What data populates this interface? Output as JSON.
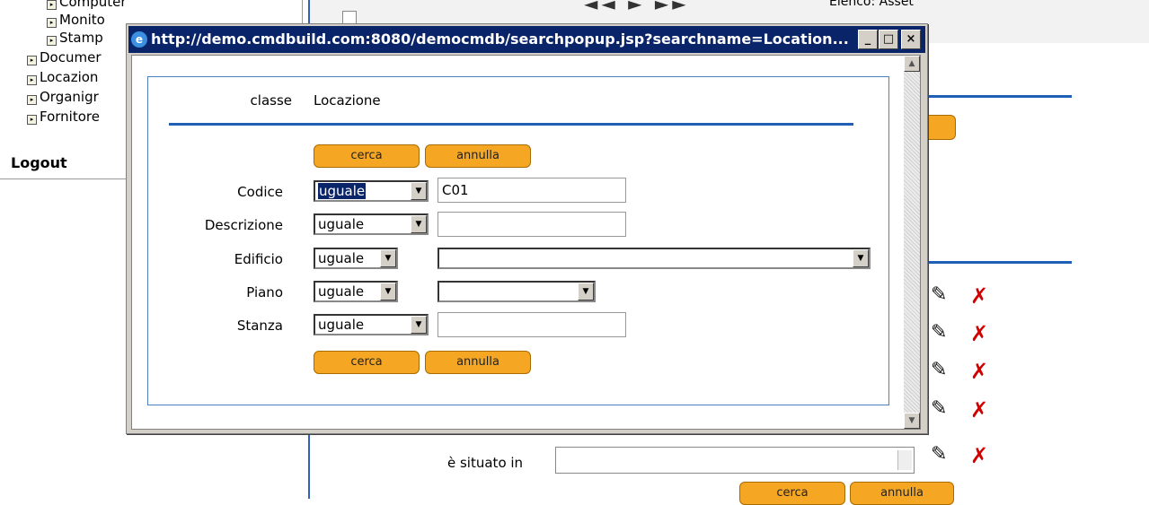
{
  "sidebar": {
    "items": [
      {
        "label": "Computer",
        "indent": 2
      },
      {
        "label": "Monito",
        "indent": 2
      },
      {
        "label": "Stamp",
        "indent": 2
      },
      {
        "label": "Documer",
        "indent": 1
      },
      {
        "label": "Locazion",
        "indent": 1
      },
      {
        "label": "Organigr",
        "indent": 1
      },
      {
        "label": "Fornitore",
        "indent": 1
      }
    ],
    "logout": "Logout"
  },
  "background": {
    "list_title": "Elenco: Asset",
    "situato_label": "è situato in",
    "search_label": "cerca",
    "cancel_label": "annulla"
  },
  "popup": {
    "title": "http://demo.cmdbuild.com:8080/democmdb/searchpopup.jsp?searchname=Location...",
    "window_buttons": {
      "minimize": "_",
      "maximize": "□",
      "close": "×"
    },
    "class_label": "classe",
    "class_value": "Locazione",
    "search_label": "cerca",
    "cancel_label": "annulla",
    "fields": [
      {
        "label": "Codice",
        "operator": "uguale",
        "value": "C01"
      },
      {
        "label": "Descrizione",
        "operator": "uguale",
        "value": ""
      },
      {
        "label": "Edificio",
        "operator": "uguale",
        "value": ""
      },
      {
        "label": "Piano",
        "operator": "uguale",
        "value": ""
      },
      {
        "label": "Stanza",
        "operator": "uguale",
        "value": ""
      }
    ]
  },
  "colors": {
    "accent_orange": "#f5a623",
    "accent_blue": "#1f5fb5",
    "titlebar": "#0a246a",
    "delete_red": "#d10000"
  },
  "icons": [
    "ie-icon",
    "edit-icon",
    "delete-icon",
    "dropdown-arrow-icon",
    "tree-expand-icon",
    "scroll-up-icon",
    "scroll-down-icon"
  ]
}
